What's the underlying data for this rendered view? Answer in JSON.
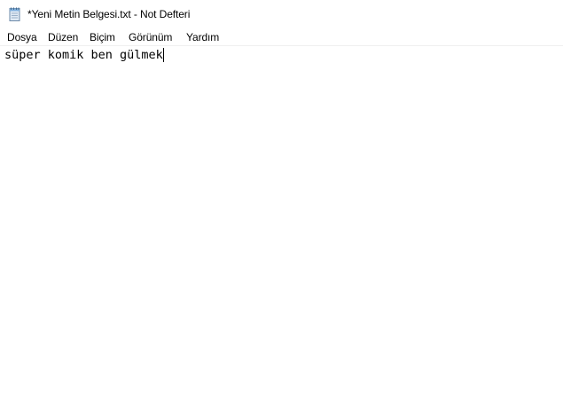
{
  "window": {
    "title": "*Yeni Metin Belgesi.txt - Not Defteri",
    "icon": "notepad-icon"
  },
  "menubar": {
    "items": [
      {
        "label": "Dosya"
      },
      {
        "label": "Düzen"
      },
      {
        "label": "Biçim"
      },
      {
        "label": "Görünüm"
      },
      {
        "label": "Yardım"
      }
    ]
  },
  "editor": {
    "content": "süper komik ben gülmek"
  }
}
